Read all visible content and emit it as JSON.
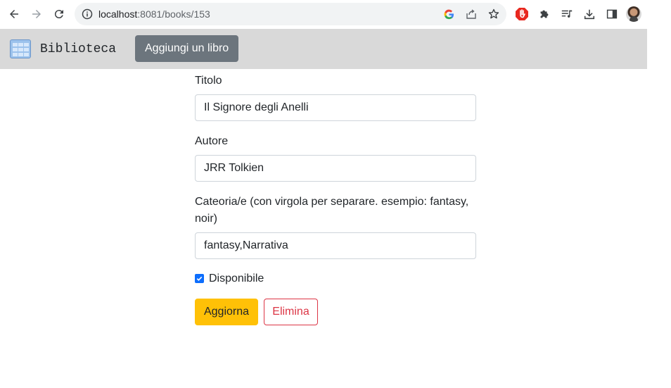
{
  "browser": {
    "url_host": "localhost",
    "url_path": ":8081/books/153",
    "icons": [
      "back-icon",
      "forward-icon",
      "reload-icon",
      "info-icon",
      "google-icon",
      "share-icon",
      "bookmark-star-icon",
      "adblock-icon",
      "extensions-icon",
      "media-icon",
      "download-icon",
      "side-panel-icon",
      "profile-avatar"
    ]
  },
  "navbar": {
    "brand": "Biblioteca",
    "add_book_label": "Aggiungi un libro",
    "background": "#d9d9d9"
  },
  "form": {
    "title_label": "Titolo",
    "title_value": "Il Signore degli Anelli",
    "author_label": "Autore",
    "author_value": "JRR Tolkien",
    "category_label_line1": "Cateoria/e (con virgola per separare. esempio: fantasy,",
    "category_label_line2": "noir)",
    "category_value": "fantasy,Narrativa",
    "available_label": "Disponibile",
    "available_checked": true,
    "update_label": "Aggiorna",
    "delete_label": "Elimina"
  },
  "colors": {
    "update_button": "#ffc107",
    "delete_border": "#dc3545",
    "checkbox": "#0d6efd",
    "add_button": "#6c757d"
  }
}
